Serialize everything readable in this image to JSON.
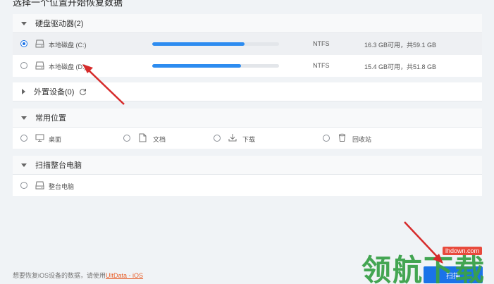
{
  "header": {
    "title": "选择一个位置开始恢复数据"
  },
  "sections": {
    "hard_drives": {
      "label": "硬盘驱动器(2)",
      "drives": [
        {
          "name": "本地磁盘 (C:)",
          "fs": "NTFS",
          "usage": "16.3 GB可用，共59.1 GB",
          "used_fraction": 0.73,
          "selected": true
        },
        {
          "name": "本地磁盘 (D:)",
          "fs": "NTFS",
          "usage": "15.4 GB可用，共51.8 GB",
          "used_fraction": 0.7,
          "selected": false
        }
      ]
    },
    "external": {
      "label": "外置设备(0)"
    },
    "common": {
      "label": "常用位置",
      "items": [
        "桌面",
        "文档",
        "下载",
        "回收站"
      ]
    },
    "full_scan": {
      "label": "扫描整台电脑",
      "item": "整台电脑"
    }
  },
  "footer": {
    "text": "想要恢复iOS设备的数据，请使用",
    "link": "UltData - iOS"
  },
  "scan_button": {
    "label": "扫描"
  },
  "watermark": {
    "text": "领航下载",
    "url": "lhdown.com"
  },
  "colors": {
    "accent": "#1a73e8",
    "progress": "#2d8cf0",
    "arrow": "#d62b2b",
    "watermark": "#3aa14a"
  }
}
